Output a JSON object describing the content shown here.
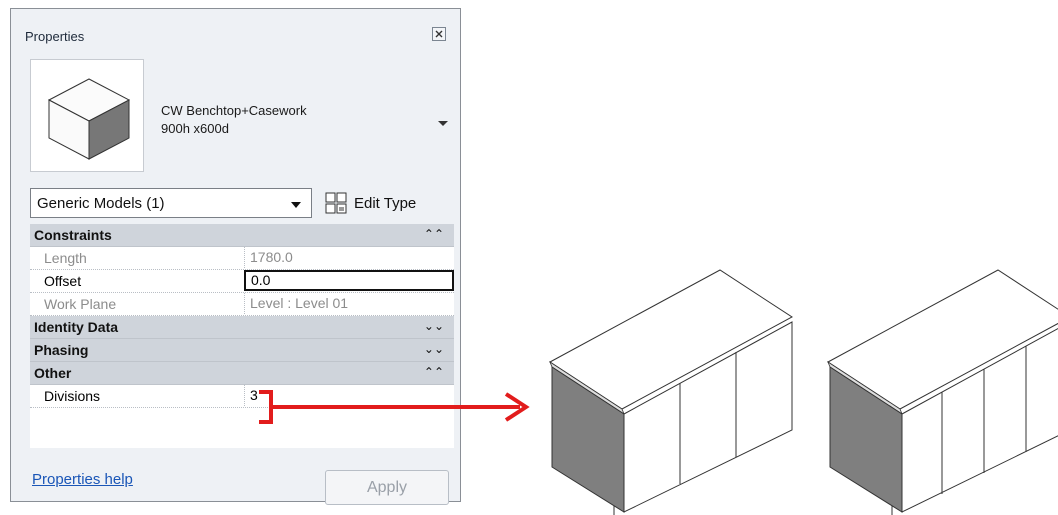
{
  "panel": {
    "title": "Properties",
    "close_icon": "close-icon",
    "type_selector": {
      "name_line1": "CW Benchtop+Casework",
      "name_line2": "900h x600d",
      "thumbnail_icon": "casework-box-icon",
      "dropdown_icon": "chevron-down-icon"
    },
    "filter": {
      "value": "Generic Models (1)"
    },
    "edit_type": {
      "label": "Edit Type",
      "icon": "edit-type-icon"
    },
    "sections": {
      "constraints": {
        "label": "Constraints",
        "state": "expanded"
      },
      "identity": {
        "label": "Identity Data",
        "state": "collapsed"
      },
      "phasing": {
        "label": "Phasing",
        "state": "collapsed"
      },
      "other": {
        "label": "Other",
        "state": "expanded"
      }
    },
    "params": {
      "length": {
        "name": "Length",
        "value": "1780.0"
      },
      "offset": {
        "name": "Offset",
        "value": "0.0"
      },
      "work_plane": {
        "name": "Work Plane",
        "value": "Level : Level 01"
      },
      "divisions": {
        "name": "Divisions",
        "value": "3"
      }
    },
    "help_link": "Properties help",
    "apply_label": "Apply"
  },
  "colors": {
    "callout": "#e21c1c",
    "section_bg": "#cfd4db",
    "panel_bg": "#eef1f5",
    "model_side": "#7f7f7f"
  }
}
